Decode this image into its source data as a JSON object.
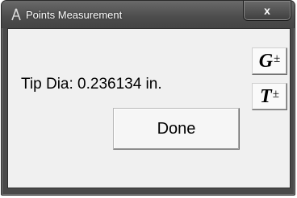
{
  "window": {
    "title": "Points Measurement",
    "close_label": "x",
    "icon": "caliper-icon"
  },
  "main": {
    "tip_label": "Tip Dia: 0.236134 in.",
    "done_label": "Done"
  },
  "side_buttons": {
    "g_letter": "G",
    "g_sign": "±",
    "t_letter": "T",
    "t_sign": "±"
  }
}
